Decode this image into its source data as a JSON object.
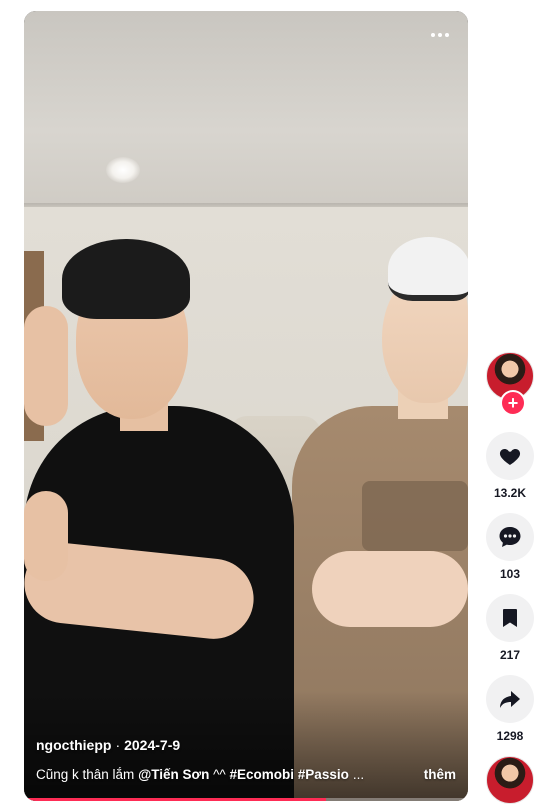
{
  "video": {
    "author": "ngocthiepp",
    "separator": "·",
    "date": "2024-7-9",
    "caption_prefix": "Cũng k thân lắm ",
    "mention": "@Tiến Sơn",
    "caption_mid": " ^^ ",
    "hashtags": [
      "#Ecomobi",
      "#Passio"
    ],
    "ellipsis": "...",
    "more_label": "thêm",
    "progress_fraction": 0.68,
    "options_icon": "more-horizontal-icon"
  },
  "actions": {
    "avatar_follow_symbol": "+",
    "like": {
      "icon": "heart-icon",
      "count": "13.2K"
    },
    "comment": {
      "icon": "comment-icon",
      "count": "103"
    },
    "save": {
      "icon": "bookmark-icon",
      "count": "217"
    },
    "share": {
      "icon": "share-icon",
      "count": "1298"
    }
  },
  "colors": {
    "accent": "#fe2c55",
    "rail_button_bg": "#f1f1f2",
    "count_text": "#161823"
  }
}
